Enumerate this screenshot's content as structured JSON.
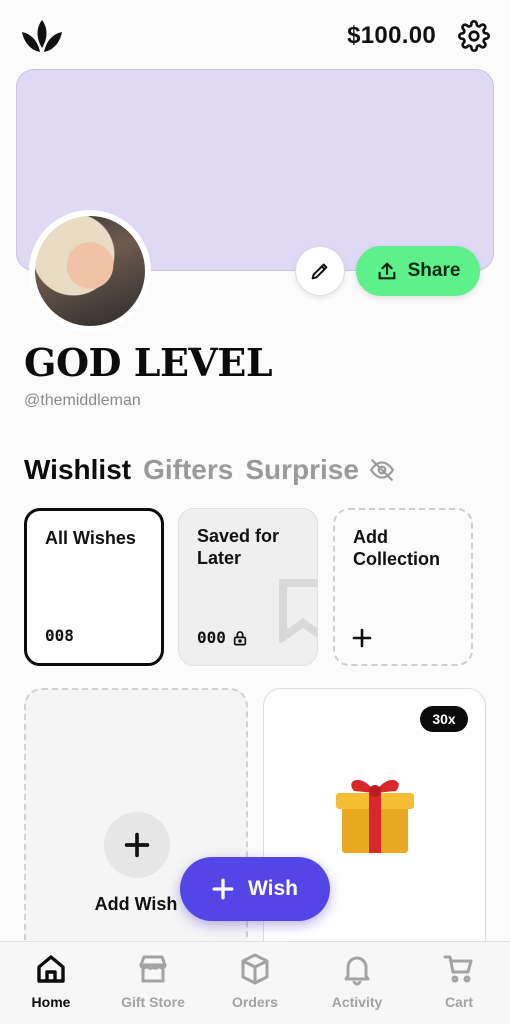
{
  "header": {
    "balance": "$100.00"
  },
  "profile": {
    "name": "GOD LEVEL",
    "handle": "@themiddleman",
    "share_label": "Share"
  },
  "tabs": [
    {
      "label": "Wishlist",
      "active": true
    },
    {
      "label": "Gifters",
      "active": false
    },
    {
      "label": "Surprise",
      "active": false
    }
  ],
  "collections": {
    "all": {
      "title": "All Wishes",
      "count": "008"
    },
    "saved": {
      "title": "Saved for Later",
      "count": "000"
    },
    "add": {
      "title": "Add Collection"
    }
  },
  "wishes": {
    "add_label": "Add Wish",
    "gift_quantity": "30x"
  },
  "fab": {
    "label": "Wish"
  },
  "nav": [
    {
      "label": "Home",
      "icon": "home-icon",
      "active": true
    },
    {
      "label": "Gift Store",
      "icon": "store-icon",
      "active": false
    },
    {
      "label": "Orders",
      "icon": "box-icon",
      "active": false
    },
    {
      "label": "Activity",
      "icon": "bell-icon",
      "active": false
    },
    {
      "label": "Cart",
      "icon": "cart-icon",
      "active": false
    }
  ],
  "colors": {
    "banner": "#dfd9f6",
    "share": "#5ef08a",
    "fab": "#5346e6"
  }
}
